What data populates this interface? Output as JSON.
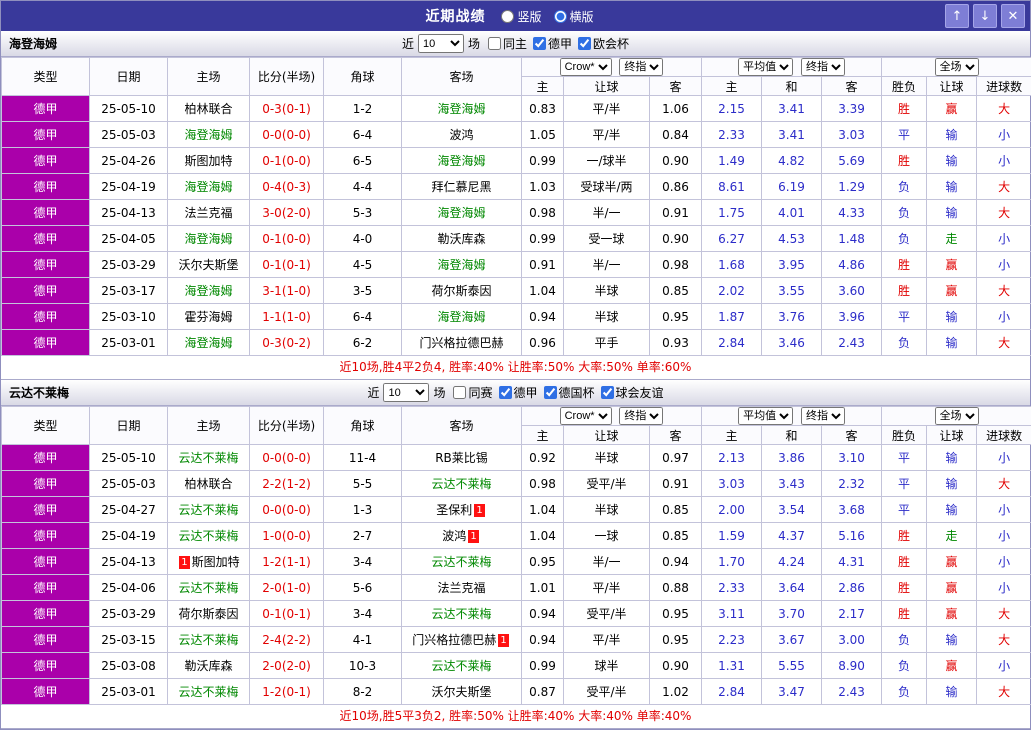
{
  "titlebar": {
    "title": "近期战绩",
    "layout_options": [
      {
        "label": "竖版",
        "selected": false
      },
      {
        "label": "横版",
        "selected": true
      }
    ],
    "up_button": "↑",
    "down_button": "↓",
    "close_button": "✕"
  },
  "colors": {
    "titlebar_bg": "#39399b",
    "league_badge_bg": "#aa00aa",
    "focus_team": "#008800",
    "win_red": "#e10000",
    "lose_blue": "#2b2bc8",
    "push_green": "#008800"
  },
  "table_header": {
    "static_cols": [
      "类型",
      "日期",
      "主场",
      "比分(半场)",
      "角球",
      "客场"
    ],
    "odds_source_select": "Crow*",
    "odds_period_select": "终指",
    "avg_source_select": "平均值",
    "avg_period_select": "终指",
    "scope_select": "全场",
    "odds_sub": [
      "主",
      "让球",
      "客"
    ],
    "avg_sub": [
      "主",
      "和",
      "客"
    ],
    "result_sub": [
      "胜负",
      "让球",
      "进球数"
    ]
  },
  "sections": [
    {
      "team": "海登海姆",
      "filter": {
        "recent_label": "近",
        "count": "10",
        "games_label": "场",
        "checkboxes": [
          {
            "label": "同主",
            "checked": false
          },
          {
            "label": "德甲",
            "checked": true
          },
          {
            "label": "欧会杯",
            "checked": true
          }
        ]
      },
      "rows": [
        {
          "lg": "德甲",
          "dt": "25-05-10",
          "hm": "柏林联合",
          "hf": 0,
          "sc": "0-3(0-1)",
          "cn": "1-2",
          "aw": "海登海姆",
          "af": 1,
          "oh": "0.83",
          "ln": "平/半",
          "oa": "1.06",
          "ah": "2.15",
          "ad": "3.41",
          "aa": "3.39",
          "rs": "胜",
          "lt": "赢",
          "gl": "大"
        },
        {
          "lg": "德甲",
          "dt": "25-05-03",
          "hm": "海登海姆",
          "hf": 1,
          "sc": "0-0(0-0)",
          "cn": "6-4",
          "aw": "波鸿",
          "af": 0,
          "oh": "1.05",
          "ln": "平/半",
          "oa": "0.84",
          "ah": "2.33",
          "ad": "3.41",
          "aa": "3.03",
          "rs": "平",
          "lt": "输",
          "gl": "小"
        },
        {
          "lg": "德甲",
          "dt": "25-04-26",
          "hm": "斯图加特",
          "hf": 0,
          "sc": "0-1(0-0)",
          "cn": "6-5",
          "aw": "海登海姆",
          "af": 1,
          "oh": "0.99",
          "ln": "一/球半",
          "oa": "0.90",
          "ah": "1.49",
          "ad": "4.82",
          "aa": "5.69",
          "rs": "胜",
          "lt": "输",
          "gl": "小"
        },
        {
          "lg": "德甲",
          "dt": "25-04-19",
          "hm": "海登海姆",
          "hf": 1,
          "sc": "0-4(0-3)",
          "cn": "4-4",
          "aw": "拜仁慕尼黑",
          "af": 0,
          "oh": "1.03",
          "ln": "受球半/两",
          "oa": "0.86",
          "ah": "8.61",
          "ad": "6.19",
          "aa": "1.29",
          "rs": "负",
          "lt": "输",
          "gl": "大"
        },
        {
          "lg": "德甲",
          "dt": "25-04-13",
          "hm": "法兰克福",
          "hf": 0,
          "sc": "3-0(2-0)",
          "cn": "5-3",
          "aw": "海登海姆",
          "af": 1,
          "oh": "0.98",
          "ln": "半/一",
          "oa": "0.91",
          "ah": "1.75",
          "ad": "4.01",
          "aa": "4.33",
          "rs": "负",
          "lt": "输",
          "gl": "大"
        },
        {
          "lg": "德甲",
          "dt": "25-04-05",
          "hm": "海登海姆",
          "hf": 1,
          "sc": "0-1(0-0)",
          "cn": "4-0",
          "aw": "勒沃库森",
          "af": 0,
          "oh": "0.99",
          "ln": "受一球",
          "oa": "0.90",
          "ah": "6.27",
          "ad": "4.53",
          "aa": "1.48",
          "rs": "负",
          "lt": "走",
          "gl": "小"
        },
        {
          "lg": "德甲",
          "dt": "25-03-29",
          "hm": "沃尔夫斯堡",
          "hf": 0,
          "sc": "0-1(0-1)",
          "cn": "4-5",
          "aw": "海登海姆",
          "af": 1,
          "oh": "0.91",
          "ln": "半/一",
          "oa": "0.98",
          "ah": "1.68",
          "ad": "3.95",
          "aa": "4.86",
          "rs": "胜",
          "lt": "赢",
          "gl": "小"
        },
        {
          "lg": "德甲",
          "dt": "25-03-17",
          "hm": "海登海姆",
          "hf": 1,
          "sc": "3-1(1-0)",
          "cn": "3-5",
          "aw": "荷尔斯泰因",
          "af": 0,
          "oh": "1.04",
          "ln": "半球",
          "oa": "0.85",
          "ah": "2.02",
          "ad": "3.55",
          "aa": "3.60",
          "rs": "胜",
          "lt": "赢",
          "gl": "大"
        },
        {
          "lg": "德甲",
          "dt": "25-03-10",
          "hm": "霍芬海姆",
          "hf": 0,
          "sc": "1-1(1-0)",
          "cn": "6-4",
          "aw": "海登海姆",
          "af": 1,
          "oh": "0.94",
          "ln": "半球",
          "oa": "0.95",
          "ah": "1.87",
          "ad": "3.76",
          "aa": "3.96",
          "rs": "平",
          "lt": "输",
          "gl": "小"
        },
        {
          "lg": "德甲",
          "dt": "25-03-01",
          "hm": "海登海姆",
          "hf": 1,
          "sc": "0-3(0-2)",
          "cn": "6-2",
          "aw": "门兴格拉德巴赫",
          "af": 0,
          "oh": "0.96",
          "ln": "平手",
          "oa": "0.93",
          "ah": "2.84",
          "ad": "3.46",
          "aa": "2.43",
          "rs": "负",
          "lt": "输",
          "gl": "大"
        }
      ],
      "summary": "近10场,胜4平2负4, 胜率:40% 让胜率:50% 大率:50% 单率:60%"
    },
    {
      "team": "云达不莱梅",
      "filter": {
        "recent_label": "近",
        "count": "10",
        "games_label": "场",
        "checkboxes": [
          {
            "label": "同赛",
            "checked": false
          },
          {
            "label": "德甲",
            "checked": true
          },
          {
            "label": "德国杯",
            "checked": true
          },
          {
            "label": "球会友谊",
            "checked": true
          }
        ]
      },
      "rows": [
        {
          "lg": "德甲",
          "dt": "25-05-10",
          "hm": "云达不莱梅",
          "hf": 1,
          "sc": "0-0(0-0)",
          "cn": "11-4",
          "aw": "RB莱比锡",
          "af": 0,
          "oh": "0.92",
          "ln": "半球",
          "oa": "0.97",
          "ah": "2.13",
          "ad": "3.86",
          "aa": "3.10",
          "rs": "平",
          "lt": "输",
          "gl": "小"
        },
        {
          "lg": "德甲",
          "dt": "25-05-03",
          "hm": "柏林联合",
          "hf": 0,
          "sc": "2-2(1-2)",
          "cn": "5-5",
          "aw": "云达不莱梅",
          "af": 1,
          "oh": "0.98",
          "ln": "受平/半",
          "oa": "0.91",
          "ah": "3.03",
          "ad": "3.43",
          "aa": "2.32",
          "rs": "平",
          "lt": "输",
          "gl": "大"
        },
        {
          "lg": "德甲",
          "dt": "25-04-27",
          "hm": "云达不莱梅",
          "hf": 1,
          "sc": "0-0(0-0)",
          "cn": "1-3",
          "aw": "圣保利",
          "af": 0,
          "ab": "1",
          "oh": "1.04",
          "ln": "半球",
          "oa": "0.85",
          "ah": "2.00",
          "ad": "3.54",
          "aa": "3.68",
          "rs": "平",
          "lt": "输",
          "gl": "小"
        },
        {
          "lg": "德甲",
          "dt": "25-04-19",
          "hm": "云达不莱梅",
          "hf": 1,
          "sc": "1-0(0-0)",
          "cn": "2-7",
          "aw": "波鸿",
          "af": 0,
          "ab": "1",
          "oh": "1.04",
          "ln": "一球",
          "oa": "0.85",
          "ah": "1.59",
          "ad": "4.37",
          "aa": "5.16",
          "rs": "胜",
          "lt": "走",
          "gl": "小"
        },
        {
          "lg": "德甲",
          "dt": "25-04-13",
          "hm": "斯图加特",
          "hf": 0,
          "hb": "1",
          "hbp": 1,
          "sc": "1-2(1-1)",
          "cn": "3-4",
          "aw": "云达不莱梅",
          "af": 1,
          "oh": "0.95",
          "ln": "半/一",
          "oa": "0.94",
          "ah": "1.70",
          "ad": "4.24",
          "aa": "4.31",
          "rs": "胜",
          "lt": "赢",
          "gl": "小"
        },
        {
          "lg": "德甲",
          "dt": "25-04-06",
          "hm": "云达不莱梅",
          "hf": 1,
          "sc": "2-0(1-0)",
          "cn": "5-6",
          "aw": "法兰克福",
          "af": 0,
          "oh": "1.01",
          "ln": "平/半",
          "oa": "0.88",
          "ah": "2.33",
          "ad": "3.64",
          "aa": "2.86",
          "rs": "胜",
          "lt": "赢",
          "gl": "小"
        },
        {
          "lg": "德甲",
          "dt": "25-03-29",
          "hm": "荷尔斯泰因",
          "hf": 0,
          "sc": "0-1(0-1)",
          "cn": "3-4",
          "aw": "云达不莱梅",
          "af": 1,
          "oh": "0.94",
          "ln": "受平/半",
          "oa": "0.95",
          "ah": "3.11",
          "ad": "3.70",
          "aa": "2.17",
          "rs": "胜",
          "lt": "赢",
          "gl": "大"
        },
        {
          "lg": "德甲",
          "dt": "25-03-15",
          "hm": "云达不莱梅",
          "hf": 1,
          "sc": "2-4(2-2)",
          "cn": "4-1",
          "aw": "门兴格拉德巴赫",
          "af": 0,
          "ab": "1",
          "oh": "0.94",
          "ln": "平/半",
          "oa": "0.95",
          "ah": "2.23",
          "ad": "3.67",
          "aa": "3.00",
          "rs": "负",
          "lt": "输",
          "gl": "大"
        },
        {
          "lg": "德甲",
          "dt": "25-03-08",
          "hm": "勒沃库森",
          "hf": 0,
          "sc": "2-0(2-0)",
          "cn": "10-3",
          "aw": "云达不莱梅",
          "af": 1,
          "oh": "0.99",
          "ln": "球半",
          "oa": "0.90",
          "ah": "1.31",
          "ad": "5.55",
          "aa": "8.90",
          "rs": "负",
          "lt": "赢",
          "gl": "小"
        },
        {
          "lg": "德甲",
          "dt": "25-03-01",
          "hm": "云达不莱梅",
          "hf": 1,
          "sc": "1-2(0-1)",
          "cn": "8-2",
          "aw": "沃尔夫斯堡",
          "af": 0,
          "oh": "0.87",
          "ln": "受平/半",
          "oa": "1.02",
          "ah": "2.84",
          "ad": "3.47",
          "aa": "2.43",
          "rs": "负",
          "lt": "输",
          "gl": "大"
        }
      ],
      "summary": "近10场,胜5平3负2, 胜率:50% 让胜率:40% 大率:40% 单率:40%"
    }
  ]
}
